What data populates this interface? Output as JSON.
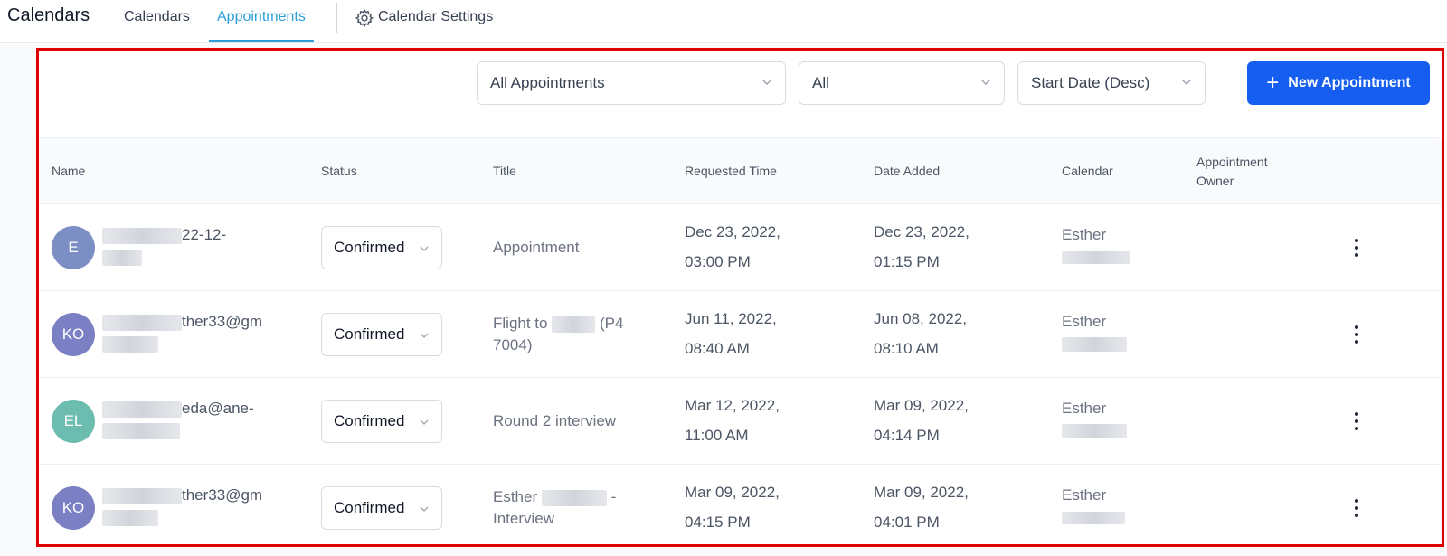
{
  "nav": {
    "app_title": "Calendars",
    "tabs": [
      {
        "label": "Calendars",
        "active": false
      },
      {
        "label": "Appointments",
        "active": true
      }
    ],
    "settings_label": "Calendar Settings"
  },
  "filters": {
    "appointments_filter": "All Appointments",
    "status_filter": "All",
    "sort": "Start Date (Desc)",
    "new_button": "New Appointment"
  },
  "table": {
    "columns": [
      "Name",
      "Status",
      "Title",
      "Requested Time",
      "Date Added",
      "Calendar",
      "Appointment Owner"
    ],
    "rows": [
      {
        "avatar": "E",
        "avatar_color": "#7b8fc4",
        "name_visible": "22-12-",
        "status": "Confirmed",
        "title": "Appointment",
        "requested_date": "Dec 23, 2022,",
        "requested_time": "03:00 PM",
        "added_date": "Dec 23, 2022,",
        "added_time": "01:15 PM",
        "calendar": "Esther"
      },
      {
        "avatar": "KO",
        "avatar_color": "#7b7fc4",
        "name_visible": "ther33@gm",
        "status": "Confirmed",
        "title_prefix": "Flight to",
        "title_suffix": "(P4",
        "title_line2": "7004)",
        "requested_date": "Jun 11, 2022,",
        "requested_time": "08:40 AM",
        "added_date": "Jun 08, 2022,",
        "added_time": "08:10 AM",
        "calendar": "Esther"
      },
      {
        "avatar": "EL",
        "avatar_color": "#6cbcaf",
        "name_visible": "eda@ane-",
        "status": "Confirmed",
        "title": "Round 2 interview",
        "requested_date": "Mar 12, 2022,",
        "requested_time": "11:00 AM",
        "added_date": "Mar 09, 2022,",
        "added_time": "04:14 PM",
        "calendar": "Esther"
      },
      {
        "avatar": "KO",
        "avatar_color": "#7b7fc4",
        "name_visible": "ther33@gm",
        "status": "Confirmed",
        "title_prefix": "Esther",
        "title_suffix": "-",
        "title_line2": "Interview",
        "requested_date": "Mar 09, 2022,",
        "requested_time": "04:15 PM",
        "added_date": "Mar 09, 2022,",
        "added_time": "04:01 PM",
        "calendar": "Esther"
      }
    ]
  },
  "colors": {
    "accent": "#2a9fd8",
    "primary_button": "#155eef",
    "highlight_border": "#e00000"
  }
}
